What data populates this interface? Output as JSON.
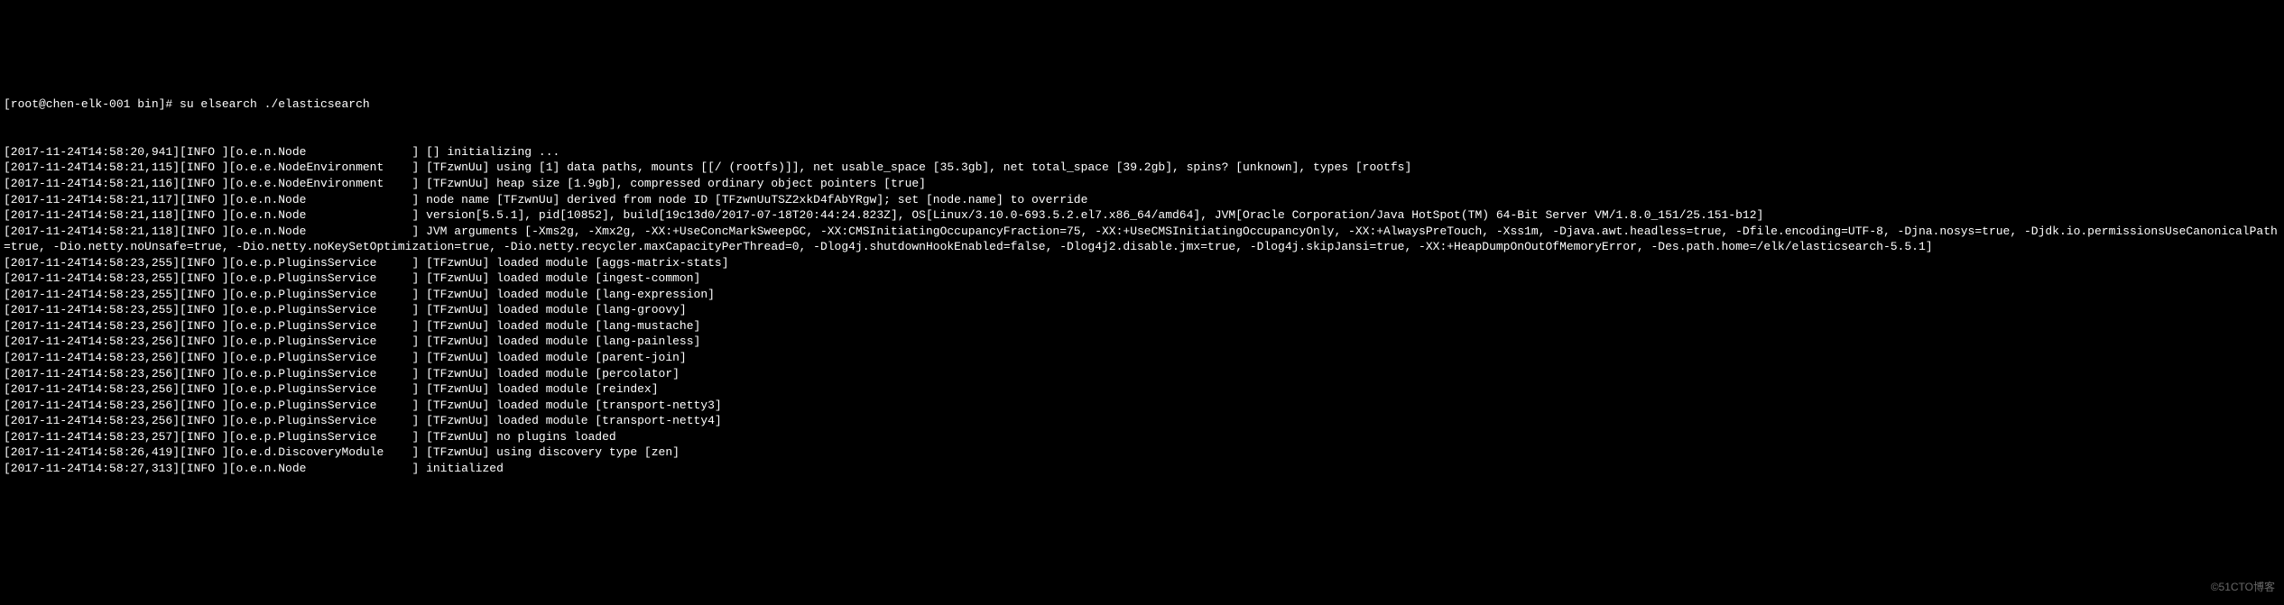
{
  "prompt": "[root@chen-elk-001 bin]# su elsearch ./elasticsearch",
  "lines": [
    "[2017-11-24T14:58:20,941][INFO ][o.e.n.Node               ] [] initializing ...",
    "[2017-11-24T14:58:21,115][INFO ][o.e.e.NodeEnvironment    ] [TFzwnUu] using [1] data paths, mounts [[/ (rootfs)]], net usable_space [35.3gb], net total_space [39.2gb], spins? [unknown], types [rootfs]",
    "[2017-11-24T14:58:21,116][INFO ][o.e.e.NodeEnvironment    ] [TFzwnUu] heap size [1.9gb], compressed ordinary object pointers [true]",
    "[2017-11-24T14:58:21,117][INFO ][o.e.n.Node               ] node name [TFzwnUu] derived from node ID [TFzwnUuTSZ2xkD4fAbYRgw]; set [node.name] to override",
    "[2017-11-24T14:58:21,118][INFO ][o.e.n.Node               ] version[5.5.1], pid[10852], build[19c13d0/2017-07-18T20:44:24.823Z], OS[Linux/3.10.0-693.5.2.el7.x86_64/amd64], JVM[Oracle Corporation/Java HotSpot(TM) 64-Bit Server VM/1.8.0_151/25.151-b12]",
    "[2017-11-24T14:58:21,118][INFO ][o.e.n.Node               ] JVM arguments [-Xms2g, -Xmx2g, -XX:+UseConcMarkSweepGC, -XX:CMSInitiatingOccupancyFraction=75, -XX:+UseCMSInitiatingOccupancyOnly, -XX:+AlwaysPreTouch, -Xss1m, -Djava.awt.headless=true, -Dfile.encoding=UTF-8, -Djna.nosys=true, -Djdk.io.permissionsUseCanonicalPath=true, -Dio.netty.noUnsafe=true, -Dio.netty.noKeySetOptimization=true, -Dio.netty.recycler.maxCapacityPerThread=0, -Dlog4j.shutdownHookEnabled=false, -Dlog4j2.disable.jmx=true, -Dlog4j.skipJansi=true, -XX:+HeapDumpOnOutOfMemoryError, -Des.path.home=/elk/elasticsearch-5.5.1]",
    "[2017-11-24T14:58:23,255][INFO ][o.e.p.PluginsService     ] [TFzwnUu] loaded module [aggs-matrix-stats]",
    "[2017-11-24T14:58:23,255][INFO ][o.e.p.PluginsService     ] [TFzwnUu] loaded module [ingest-common]",
    "[2017-11-24T14:58:23,255][INFO ][o.e.p.PluginsService     ] [TFzwnUu] loaded module [lang-expression]",
    "[2017-11-24T14:58:23,255][INFO ][o.e.p.PluginsService     ] [TFzwnUu] loaded module [lang-groovy]",
    "[2017-11-24T14:58:23,256][INFO ][o.e.p.PluginsService     ] [TFzwnUu] loaded module [lang-mustache]",
    "[2017-11-24T14:58:23,256][INFO ][o.e.p.PluginsService     ] [TFzwnUu] loaded module [lang-painless]",
    "[2017-11-24T14:58:23,256][INFO ][o.e.p.PluginsService     ] [TFzwnUu] loaded module [parent-join]",
    "[2017-11-24T14:58:23,256][INFO ][o.e.p.PluginsService     ] [TFzwnUu] loaded module [percolator]",
    "[2017-11-24T14:58:23,256][INFO ][o.e.p.PluginsService     ] [TFzwnUu] loaded module [reindex]",
    "[2017-11-24T14:58:23,256][INFO ][o.e.p.PluginsService     ] [TFzwnUu] loaded module [transport-netty3]",
    "[2017-11-24T14:58:23,256][INFO ][o.e.p.PluginsService     ] [TFzwnUu] loaded module [transport-netty4]",
    "[2017-11-24T14:58:23,257][INFO ][o.e.p.PluginsService     ] [TFzwnUu] no plugins loaded",
    "[2017-11-24T14:58:26,419][INFO ][o.e.d.DiscoveryModule    ] [TFzwnUu] using discovery type [zen]",
    "[2017-11-24T14:58:27,313][INFO ][o.e.n.Node               ] initialized"
  ],
  "watermark": "©51CTO博客"
}
